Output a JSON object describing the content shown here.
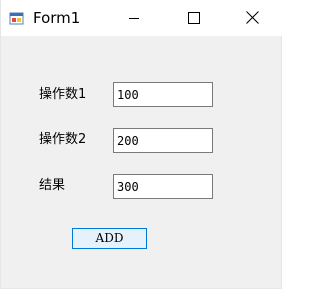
{
  "window": {
    "title": "Form1",
    "icon": "winforms-app-icon",
    "controls": {
      "minimize_icon": "minimize-icon",
      "maximize_icon": "maximize-icon",
      "close_icon": "close-icon"
    }
  },
  "form": {
    "operand1": {
      "label": "操作数1",
      "value": "100"
    },
    "operand2": {
      "label": "操作数2",
      "value": "200"
    },
    "result": {
      "label": "结果",
      "value": "300"
    },
    "add_button_label": "ADD"
  },
  "colors": {
    "client_background": "#f0f0f0",
    "titlebar_background": "#ffffff",
    "button_border": "#0078d7",
    "button_background": "#e5f1fb",
    "textbox_border": "#7a7a7a"
  }
}
